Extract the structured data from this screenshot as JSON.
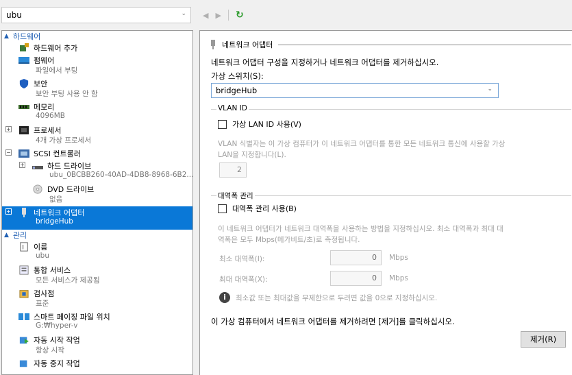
{
  "vm_selector": {
    "value": "ubu"
  },
  "left_tree": {
    "hardware_header": "하드웨어",
    "hardware_items": [
      {
        "title": "하드웨어 추가",
        "sub": ""
      },
      {
        "title": "펌웨어",
        "sub": "파일에서 부팅"
      },
      {
        "title": "보안",
        "sub": "보안 부팅 사용 안 함"
      },
      {
        "title": "메모리",
        "sub": "4096MB"
      },
      {
        "title": "프로세서",
        "sub": "4개 가상 프로세서"
      },
      {
        "title": "SCSI 컨트롤러",
        "sub": ""
      },
      {
        "title": "하드 드라이브",
        "sub": "ubu_0BCBB260-40AD-4DB8-8968-6B2..."
      },
      {
        "title": "DVD 드라이브",
        "sub": "없음"
      },
      {
        "title": "네트워크 어댑터",
        "sub": "bridgeHub"
      }
    ],
    "management_header": "관리",
    "management_items": [
      {
        "title": "이름",
        "sub": "ubu"
      },
      {
        "title": "통합 서비스",
        "sub": "모든 서비스가 제공됨"
      },
      {
        "title": "검사점",
        "sub": "표준"
      },
      {
        "title": "스마트 페이징 파일 위치",
        "sub": "G:₩hyper-v"
      },
      {
        "title": "자동 시작 작업",
        "sub": "항상 시작"
      },
      {
        "title": "자동 중지 작업",
        "sub": ""
      }
    ]
  },
  "right_panel": {
    "title": "네트워크 어댑터",
    "intro": "네트워크 어댑터 구성을 지정하거나 네트워크 어댑터를 제거하십시오.",
    "switch_label": "가상 스위치(S):",
    "switch_value": "bridgeHub",
    "vlan": {
      "group_label": "VLAN ID",
      "checkbox_label": "가상 LAN ID 사용(V)",
      "description_line1": "VLAN 식별자는 이 가상 컴퓨터가 이 네트워크 어댑터를 통한 모든 네트워크 통신에 사용할 가상",
      "description_line2": "LAN을 지정합니다(L).",
      "value": "2"
    },
    "bandwidth": {
      "group_label": "대역폭 관리",
      "checkbox_label": "대역폭 관리 사용(B)",
      "description_line1": "이 네트워크 어댑터가 네트워크 대역폭을 사용하는 방법을 지정하십시오. 최소 대역폭과 최대 대",
      "description_line2": "역폭은 모두 Mbps(메가비트/초)로 측정됩니다.",
      "min_label": "최소 대역폭(I):",
      "min_value": "0",
      "max_label": "최대 대역폭(X):",
      "max_value": "0",
      "unit": "Mbps",
      "info_text": "최소값 또는 최대값을 무제한으로 두려면 값을 0으로 지정하십시오."
    },
    "remove_text": "이 가상 컴퓨터에서 네트워크 어댑터를 제거하려면 [제거]를 클릭하십시오.",
    "remove_button": "제거(R)"
  }
}
